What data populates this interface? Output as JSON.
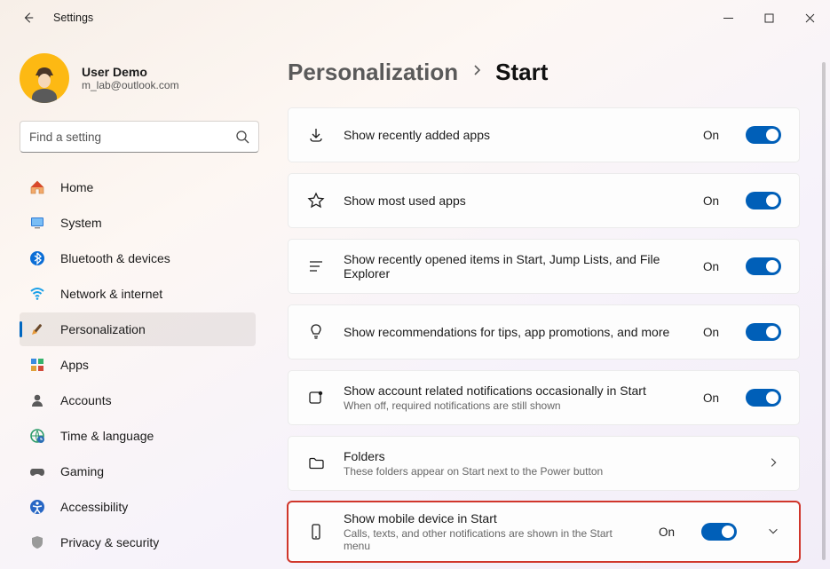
{
  "window": {
    "title": "Settings"
  },
  "user": {
    "name": "User Demo",
    "email": "m_lab@outlook.com"
  },
  "search": {
    "placeholder": "Find a setting"
  },
  "nav": {
    "items": [
      {
        "id": "home",
        "label": "Home"
      },
      {
        "id": "system",
        "label": "System"
      },
      {
        "id": "bluetooth",
        "label": "Bluetooth & devices"
      },
      {
        "id": "network",
        "label": "Network & internet"
      },
      {
        "id": "personalization",
        "label": "Personalization",
        "selected": true
      },
      {
        "id": "apps",
        "label": "Apps"
      },
      {
        "id": "accounts",
        "label": "Accounts"
      },
      {
        "id": "time",
        "label": "Time & language"
      },
      {
        "id": "gaming",
        "label": "Gaming"
      },
      {
        "id": "accessibility",
        "label": "Accessibility"
      },
      {
        "id": "privacy",
        "label": "Privacy & security"
      }
    ]
  },
  "breadcrumb": {
    "parent": "Personalization",
    "current": "Start"
  },
  "settings": [
    {
      "id": "recent-apps",
      "title": "Show recently added apps",
      "state": "On",
      "toggle": true
    },
    {
      "id": "most-used",
      "title": "Show most used apps",
      "state": "On",
      "toggle": true
    },
    {
      "id": "recent-items",
      "title": "Show recently opened items in Start, Jump Lists, and File Explorer",
      "state": "On",
      "toggle": true
    },
    {
      "id": "recommendations",
      "title": "Show recommendations for tips, app promotions, and more",
      "state": "On",
      "toggle": true
    },
    {
      "id": "account-notif",
      "title": "Show account related notifications occasionally in Start",
      "sub": "When off, required notifications are still shown",
      "state": "On",
      "toggle": true
    },
    {
      "id": "folders",
      "title": "Folders",
      "sub": "These folders appear on Start next to the Power button",
      "chevron": "right"
    },
    {
      "id": "mobile",
      "title": "Show mobile device in Start",
      "sub": "Calls, texts, and other notifications are shown in the Start menu",
      "state": "On",
      "toggle": true,
      "chevron": "down",
      "highlight": true
    }
  ]
}
